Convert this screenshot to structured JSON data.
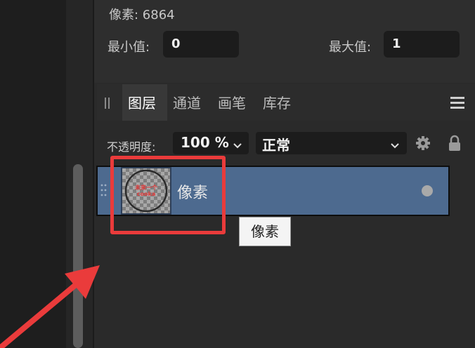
{
  "info": {
    "pixels_text": "像素: 6864",
    "min_label": "最小值:",
    "min_value": "0",
    "max_label": "最大值:",
    "max_value": "1"
  },
  "tabs": [
    {
      "label": "图层",
      "active": true
    },
    {
      "label": "通道",
      "active": false
    },
    {
      "label": "画笔",
      "active": false
    },
    {
      "label": "库存",
      "active": false
    }
  ],
  "layer_controls": {
    "opacity_label": "不透明度:",
    "opacity_value": "100 %",
    "blend_mode": "正常"
  },
  "layers": [
    {
      "name": "像素",
      "selected": true,
      "thumbnail_text": [
        "未来一个",
        "cooka"
      ]
    }
  ],
  "tooltip": "像素",
  "colors": {
    "selection": "#4d6a8f",
    "highlight": "#ea3b3b",
    "thumbnail_text": "#e23b3b"
  },
  "icons": [
    "drag-grip-icon",
    "menu-icon",
    "chevron-down-icon",
    "gear-icon",
    "lock-icon",
    "visibility-dot-icon",
    "arrow-annotation"
  ]
}
